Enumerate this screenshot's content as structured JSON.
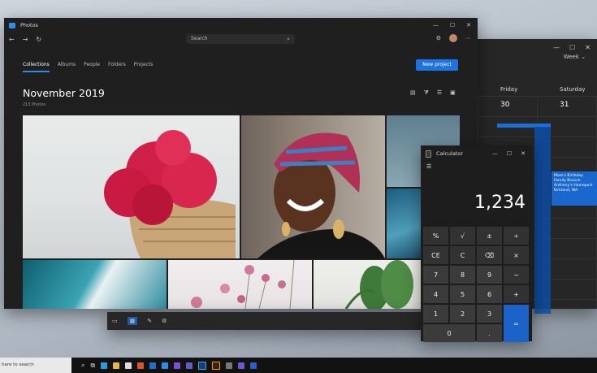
{
  "calendar": {
    "view_label": "Week ⌄",
    "days": [
      "Friday",
      "Saturday"
    ],
    "dates": [
      "30",
      "31"
    ],
    "event": {
      "title": "Mom's Birthday Family Brunch",
      "subtitle": "Anthony's Homeport",
      "location": "Kirkland, WA"
    }
  },
  "photos": {
    "window_title": "Photos",
    "search_placeholder": "Search",
    "tabs": [
      "Collections",
      "Albums",
      "People",
      "Folders",
      "Projects"
    ],
    "new_project": "New project",
    "heading": "November 2019",
    "subheading": "213 Photos"
  },
  "calculator": {
    "window_title": "Calculator",
    "display": "1,234",
    "keys": [
      "%",
      "√",
      "±",
      "÷",
      "CE",
      "C",
      "⌫",
      "×",
      "7",
      "8",
      "9",
      "−",
      "4",
      "5",
      "6",
      "+",
      "1",
      "2",
      "3",
      "",
      "0",
      "",
      ".",
      "="
    ]
  },
  "taskbar": {
    "search_text": "here to search"
  },
  "colors": {
    "accent": "#1d74e0",
    "window_bg": "#1f1f1f"
  },
  "icons": [
    "back-arrow-icon",
    "forward-arrow-icon",
    "refresh-icon",
    "search-icon",
    "settings-icon",
    "more-icon",
    "minimize-icon",
    "maximize-icon",
    "close-icon"
  ]
}
